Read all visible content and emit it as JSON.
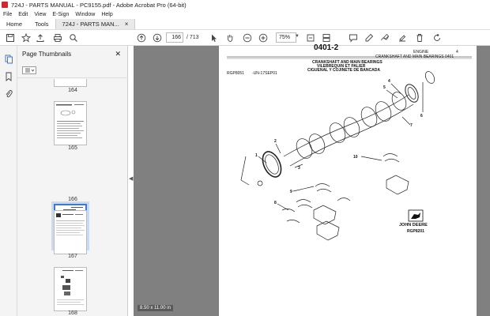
{
  "window": {
    "title": "724J - PARTS MANUAL - PC9155.pdf - Adobe Acrobat Pro (64-bit)"
  },
  "menu": [
    "File",
    "Edit",
    "View",
    "E-Sign",
    "Window",
    "Help"
  ],
  "tabs": {
    "home": "Home",
    "tools": "Tools",
    "doc": "724J - PARTS MAN..."
  },
  "toolbar": {
    "page_current": "166",
    "page_total": "/ 713",
    "zoom": "75%"
  },
  "sidebar": {
    "title": "Page Thumbnails"
  },
  "thumbnails": [
    {
      "label": "164"
    },
    {
      "label": "165"
    },
    {
      "label": "166"
    },
    {
      "label": "167"
    },
    {
      "label": "168"
    }
  ],
  "status": {
    "page_size": "8.50 x 11.00 in"
  },
  "pdf": {
    "section_number": "0401-2",
    "engine_label": "ENGINE",
    "engine_number": "4",
    "section_header": "CRANKSHAFT AND MAIN BEARINGS 0401",
    "doc_id": "RGP8051",
    "serial": "-UN-17SEP01",
    "title_en": "CRANKSHAFT AND MAIN BEARINGS",
    "title_fr": "VILEBREQUIN ET PALIER",
    "title_es": "CIGUENAL Y COJINETE DE BANCADA",
    "brand": "JOHN DEERE",
    "figure_id": "RGP8201",
    "callouts": [
      "1",
      "2",
      "3",
      "4",
      "5",
      "6",
      "7",
      "8",
      "9",
      "10"
    ]
  }
}
